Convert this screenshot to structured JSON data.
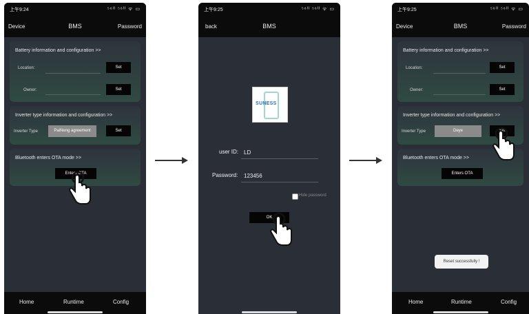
{
  "status": {
    "time1": "上午9:24",
    "time2": "上午9:25",
    "time3": "上午9:25",
    "signal": "⁵⁶ᴵᴵ ⁵⁶ᴵᴵ ᯤ ▭"
  },
  "nav": {
    "device": "Device",
    "title": "BMS",
    "password": "Password",
    "back": "back"
  },
  "battery": {
    "header": "Battery information and configuration >>",
    "location_label": "Location:",
    "owner_label": "Owner:",
    "set": "Set"
  },
  "inverter": {
    "header": "Inverter type information and configuration >>",
    "label": "Inverter Type",
    "value1": "PaiNeng agreement",
    "value3": "Deye",
    "set": "Set"
  },
  "ota": {
    "header": "Bluetooth enters OTA mode >>",
    "button": "Enters OTA"
  },
  "login": {
    "logo_text": "SUNESS",
    "user_label": "user ID:",
    "user_value": "LD",
    "pwd_label": "Password:",
    "pwd_value": "123456",
    "hide": "Hide password",
    "ok": "OK"
  },
  "toast": "Reset successfully !",
  "bottom": {
    "home": "Home",
    "runtime": "Runtime",
    "config": "Config"
  }
}
